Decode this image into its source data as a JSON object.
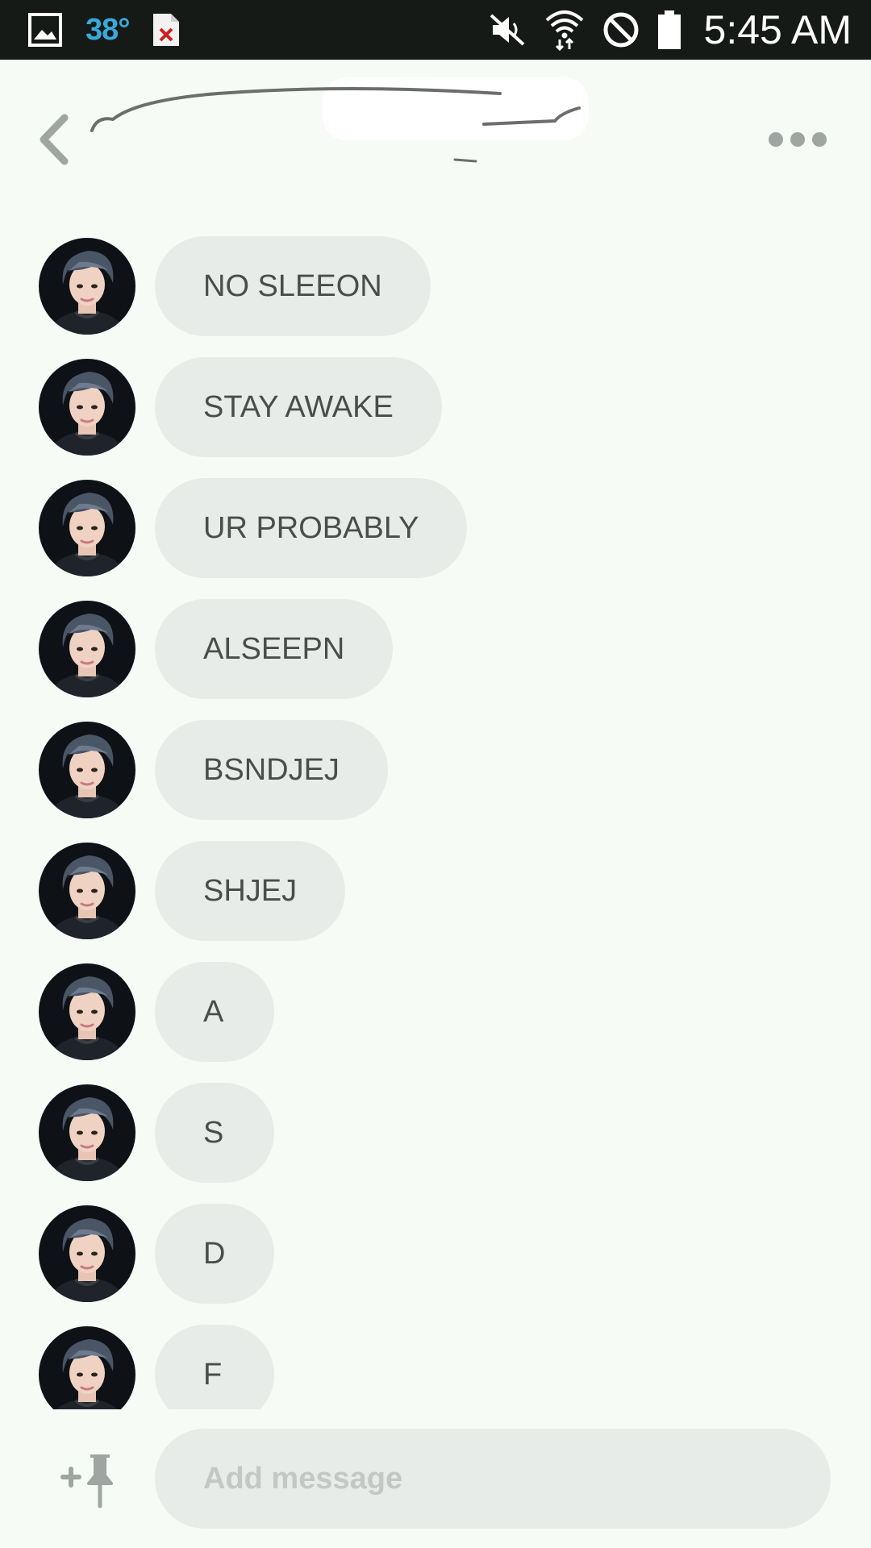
{
  "status_bar": {
    "temperature": "38°",
    "time": "5:45 AM"
  },
  "header": {
    "back_icon": "chevron-left-icon",
    "more_icon": "more-dots-icon"
  },
  "messages": [
    {
      "text": "NO SLEEON"
    },
    {
      "text": "STAY AWAKE"
    },
    {
      "text": "UR PROBABLY"
    },
    {
      "text": "ALSEEPN"
    },
    {
      "text": "BSNDJEJ"
    },
    {
      "text": "SHJEJ"
    },
    {
      "text": "A"
    },
    {
      "text": "S"
    },
    {
      "text": "D"
    },
    {
      "text": "F"
    }
  ],
  "composer": {
    "pin_icon": "add-pin-icon",
    "placeholder": "Add message"
  },
  "colors": {
    "background": "#f6fbf6",
    "bubble": "#e8ece8",
    "status_bar": "#161a17",
    "temperature": "#3aa9d9"
  }
}
